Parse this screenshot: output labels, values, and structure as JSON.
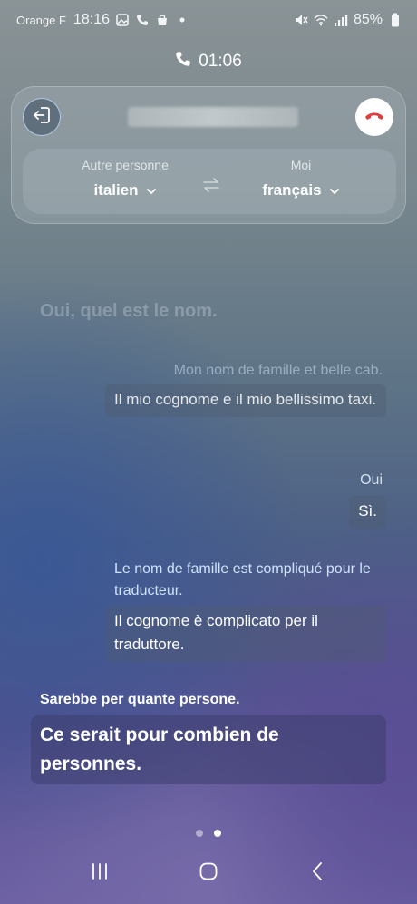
{
  "status_bar": {
    "carrier": "Orange F",
    "time": "18:16",
    "battery": "85%",
    "icons": [
      "gallery-icon",
      "phone-icon",
      "shopping-bag-icon",
      "dot-icon",
      "mute-icon",
      "wifi-icon",
      "signal-icon",
      "battery-icon"
    ]
  },
  "call": {
    "duration": "01:06",
    "icons": [
      "phone-icon",
      "exit-icon",
      "hang-up-icon"
    ],
    "hangup_color": "#e23b3b"
  },
  "languages": {
    "other_label": "Autre personne",
    "other_value": "italien",
    "me_label": "Moi",
    "me_value": "français",
    "swap_icon": "swap-arrows-icon"
  },
  "conversation": {
    "faded": "Oui, quel est le nom.",
    "messages": [
      {
        "source": "Mon nom de famille et belle cab.",
        "translation": "Il mio cognome e il mio bellissimo taxi."
      },
      {
        "source": "Oui",
        "translation": "Sì."
      },
      {
        "source": "Le nom de famille est compliqué pour le traducteur.",
        "translation": "Il cognome è complicato per il traduttore."
      }
    ],
    "current": {
      "source": "Sarebbe per quante persone.",
      "translation": "Ce serait pour combien de personnes."
    }
  },
  "pager": {
    "count": 2,
    "active": 2
  },
  "nav": {
    "icons": [
      "recent-apps-icon",
      "home-icon",
      "back-icon"
    ]
  }
}
